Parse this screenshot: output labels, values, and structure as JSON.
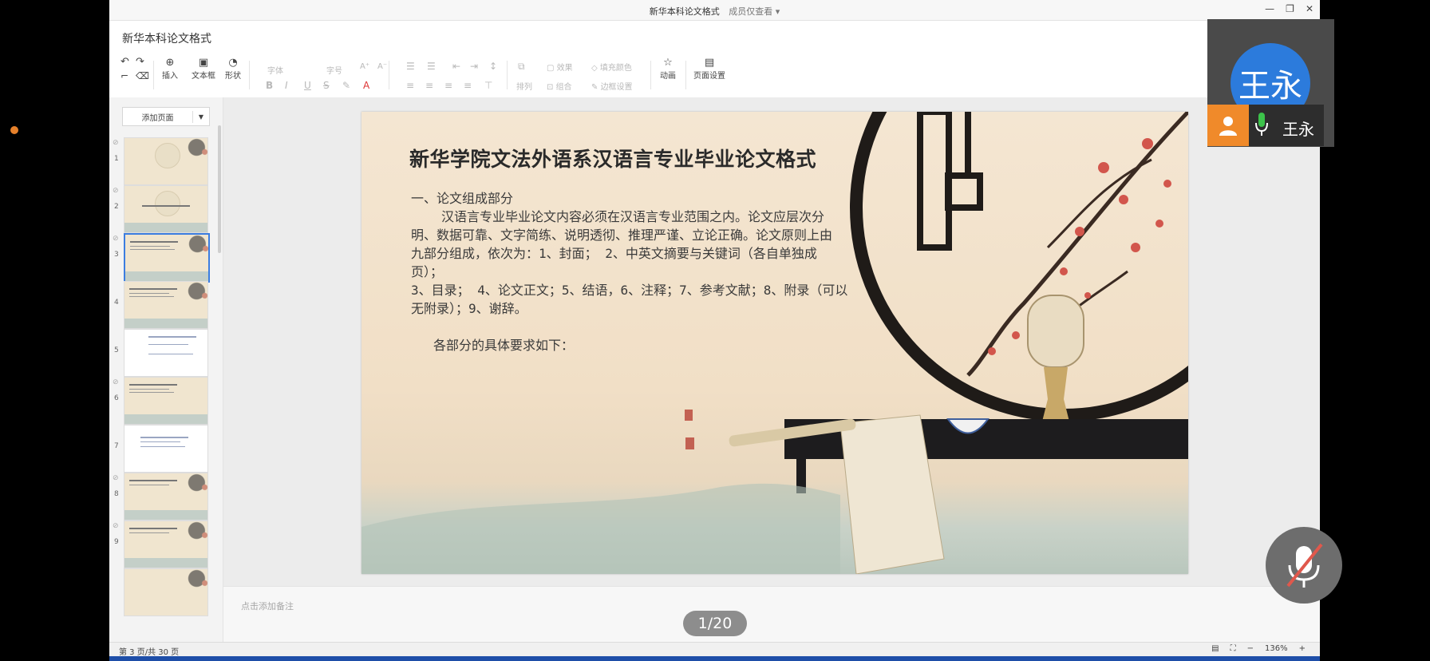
{
  "window": {
    "title": "新华本科论文格式",
    "permission": "成员仅查看 ▾"
  },
  "document": {
    "name": "新华本科论文格式"
  },
  "toolbar": {
    "insert": "插入",
    "textbox": "文本框",
    "shape": "形状",
    "font": "字体",
    "font_size": "字号",
    "effect": "效果",
    "fill_color": "填充颜色",
    "arrange": "排列",
    "group": "组合",
    "border": "边框设置",
    "animation": "动画",
    "page_setup": "页面设置"
  },
  "sidebar": {
    "add_page": "添加页面",
    "thumb_numbers": [
      "1",
      "2",
      "3",
      "4",
      "5",
      "6",
      "7",
      "8",
      "9"
    ]
  },
  "slide": {
    "title": "新华学院文法外语系汉语言专业毕业论文格式",
    "lines": [
      "一、论文组成部分",
      "汉语言专业毕业论文内容必须在汉语言专业范围之内。论文应层次分",
      "明、数据可靠、文字简练、说明透彻、推理严谨、立论正确。论文原则上由",
      "九部分组成，依次为：1、封面；  2、中英文摘要与关键词（各自单独成",
      "页）；",
      "3、目录；  4、论文正文；5、结语，6、注释；7、参考文献；8、附录（可以",
      "无附录）；9、谢辞。",
      "各部分的具体要求如下："
    ]
  },
  "notes": {
    "placeholder": "点击添加备注"
  },
  "status": {
    "page_info": "第 3 页/共 30 页",
    "zoom": "136%"
  },
  "pager": "1/20",
  "video": {
    "avatar_text": "王永",
    "participant_name": "王永"
  }
}
